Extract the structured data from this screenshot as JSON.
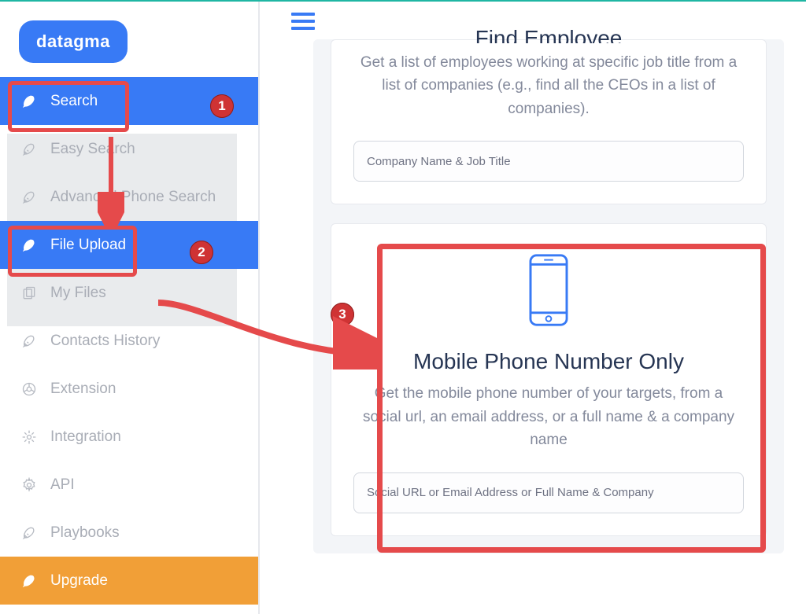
{
  "brand": {
    "name": "datagma"
  },
  "sidebar": {
    "items": [
      {
        "label": "Search",
        "icon": "rocket",
        "active": true
      },
      {
        "label": "Easy Search",
        "icon": "rocket",
        "active": false
      },
      {
        "label": "Advanced Phone Search",
        "icon": "rocket",
        "active": false
      },
      {
        "label": "File Upload",
        "icon": "rocket",
        "active": true
      },
      {
        "label": "My Files",
        "icon": "files",
        "active": false
      },
      {
        "label": "Contacts History",
        "icon": "rocket",
        "active": false
      },
      {
        "label": "Extension",
        "icon": "chrome",
        "active": false
      },
      {
        "label": "Integration",
        "icon": "hub",
        "active": false
      },
      {
        "label": "API",
        "icon": "gear",
        "active": false
      },
      {
        "label": "Playbooks",
        "icon": "rocket",
        "active": false
      },
      {
        "label": "Upgrade",
        "icon": "rocket",
        "upgrade": true
      }
    ]
  },
  "cards": {
    "find_employee": {
      "title": "Find Employee",
      "description": "Get a list of employees working at specific job title from a list of companies (e.g., find all the CEOs in a list of companies).",
      "input_placeholder": "Company Name & Job Title"
    },
    "mobile_phone": {
      "title": "Mobile Phone Number Only",
      "description": "Get the mobile phone number of your targets, from a social url, an email address, or a full name & a company name",
      "input_placeholder": "Social URL or Email Address or Full Name & Company"
    }
  },
  "annotations": {
    "badges": [
      "1",
      "2",
      "3"
    ]
  },
  "colors": {
    "primary": "#387af5",
    "upgrade": "#f19f37",
    "annotation": "#e54a4b",
    "teal_bar": "#1fb6a3"
  }
}
